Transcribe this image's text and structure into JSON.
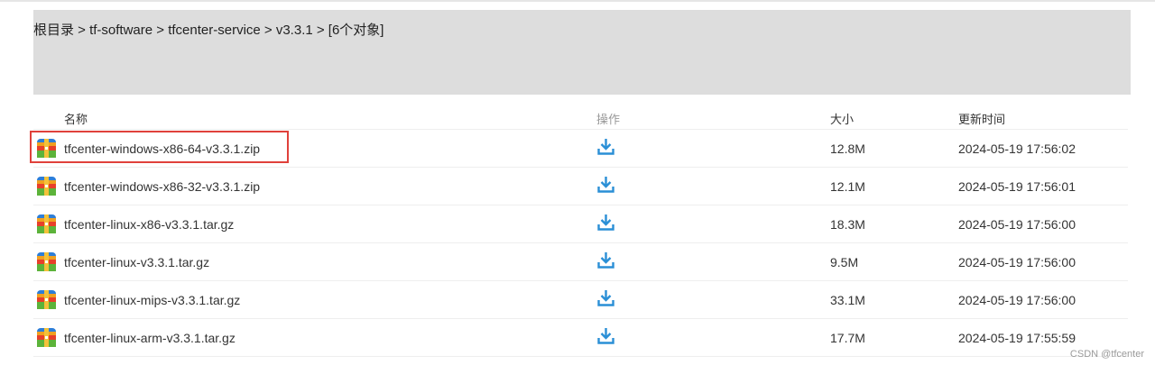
{
  "breadcrumb": "根目录 > tf-software > tfcenter-service > v3.3.1 > [6个对象]",
  "table": {
    "headers": {
      "name": "名称",
      "op": "操作",
      "size": "大小",
      "time": "更新时间"
    },
    "rows": [
      {
        "name": "tfcenter-windows-x86-64-v3.3.1.zip",
        "size": "12.8M",
        "time": "2024-05-19 17:56:02",
        "highlighted": true
      },
      {
        "name": "tfcenter-windows-x86-32-v3.3.1.zip",
        "size": "12.1M",
        "time": "2024-05-19 17:56:01"
      },
      {
        "name": "tfcenter-linux-x86-v3.3.1.tar.gz",
        "size": "18.3M",
        "time": "2024-05-19 17:56:00"
      },
      {
        "name": "tfcenter-linux-v3.3.1.tar.gz",
        "size": "9.5M",
        "time": "2024-05-19 17:56:00"
      },
      {
        "name": "tfcenter-linux-mips-v3.3.1.tar.gz",
        "size": "33.1M",
        "time": "2024-05-19 17:56:00"
      },
      {
        "name": "tfcenter-linux-arm-v3.3.1.tar.gz",
        "size": "17.7M",
        "time": "2024-05-19 17:55:59"
      }
    ]
  },
  "icons": {
    "file": "archive-icon",
    "download": "download-icon"
  },
  "colors": {
    "highlight": "#e0413b",
    "download": "#2a8fd6",
    "panel": "#dddddd"
  },
  "watermark": "CSDN @tfcenter"
}
